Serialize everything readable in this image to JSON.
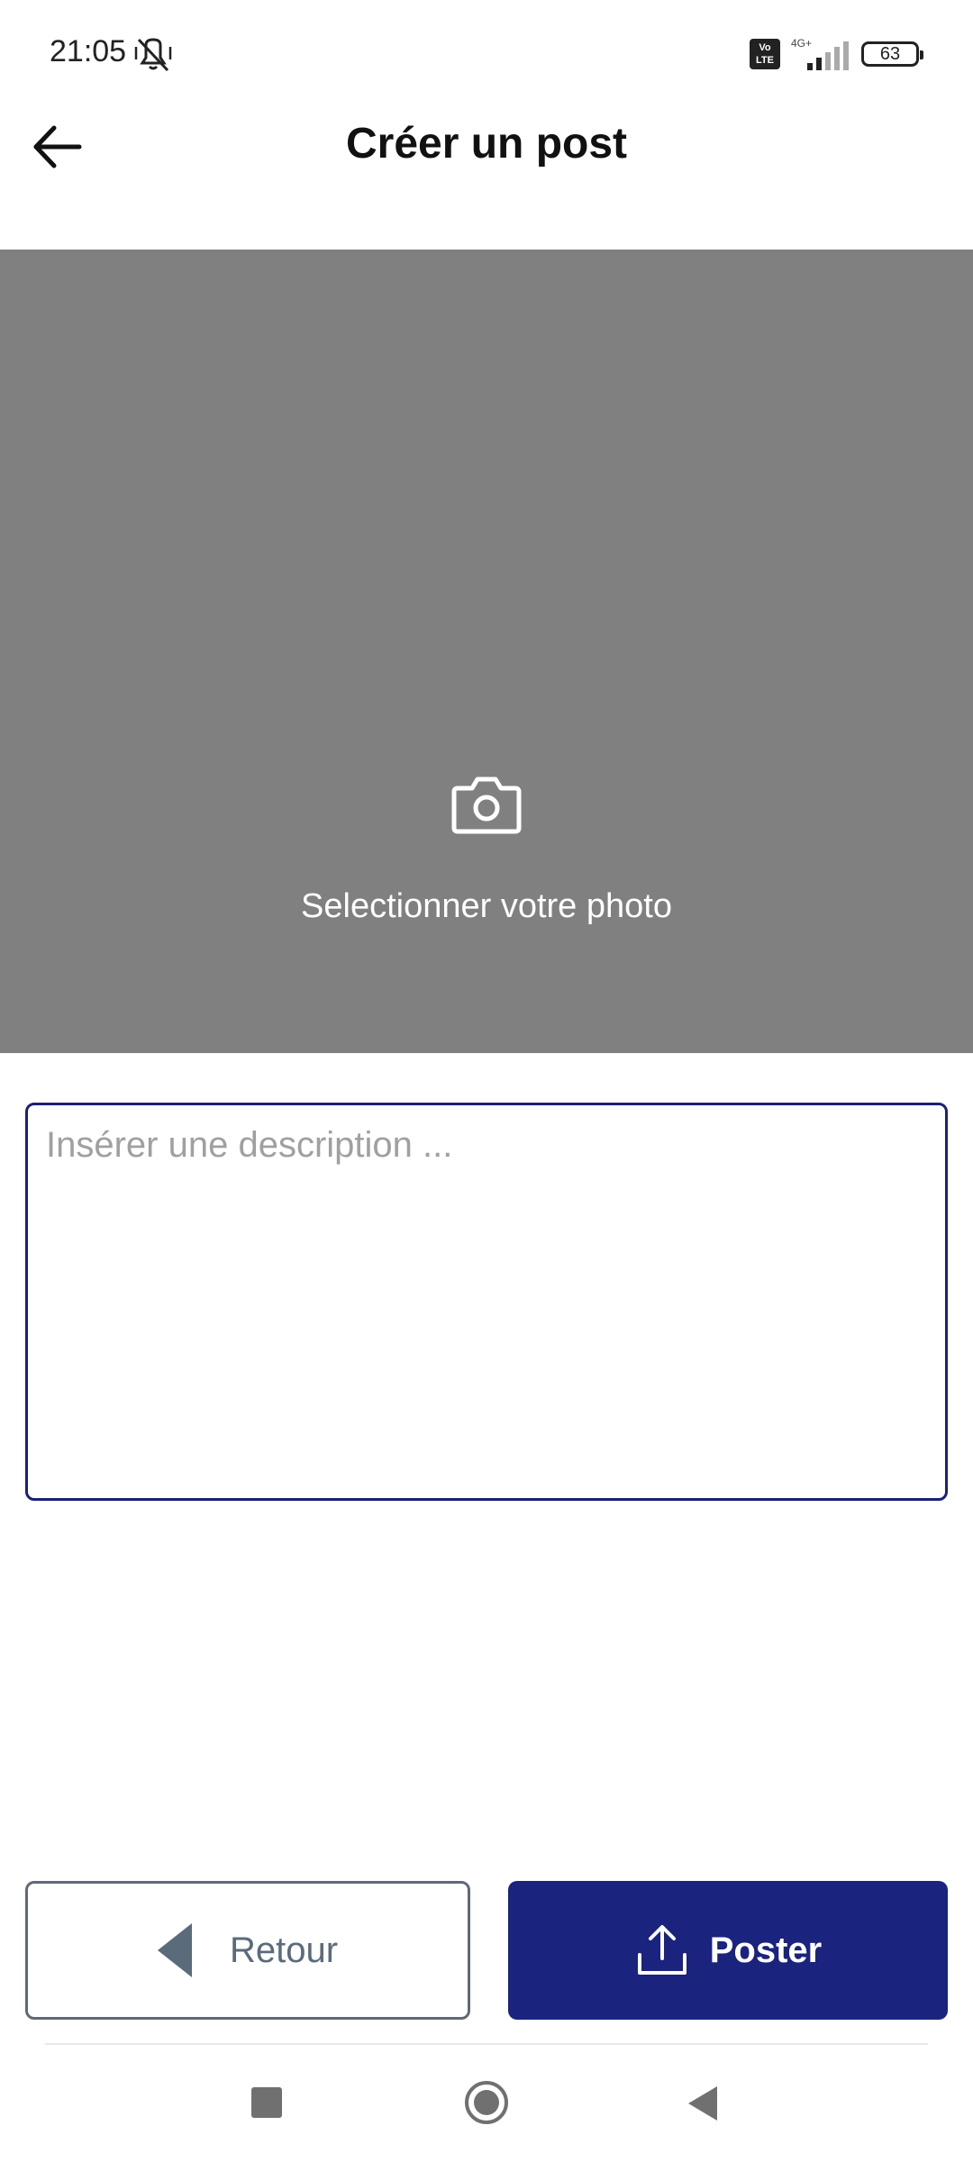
{
  "status_bar": {
    "time": "21:05",
    "mute_icon": "vibrate-off-icon",
    "volte_line1": "Vo",
    "volte_line2": "LTE",
    "network": "4G+",
    "battery": "63"
  },
  "app_bar": {
    "back_icon": "arrow-left-icon",
    "title": "Créer un post"
  },
  "photo_picker": {
    "icon": "camera-icon",
    "label": "Selectionner votre photo",
    "background": "#808080"
  },
  "description": {
    "placeholder": "Insérer une description ...",
    "value": ""
  },
  "actions": {
    "back_label": "Retour",
    "back_icon": "triangle-left-icon",
    "post_label": "Poster",
    "post_icon": "upload-icon",
    "accent": "#1a237e"
  },
  "nav_bar": {
    "recent_icon": "square-icon",
    "home_icon": "circle-icon",
    "back_icon": "triangle-left-icon"
  }
}
